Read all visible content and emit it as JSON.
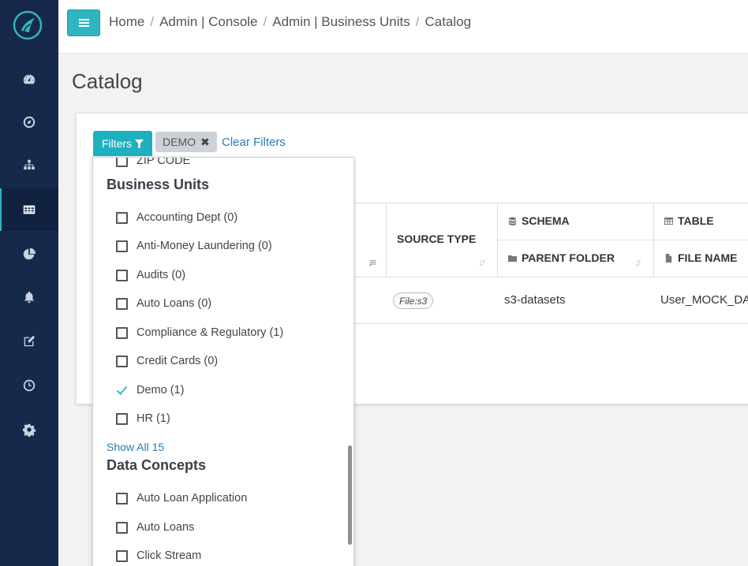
{
  "sidebar": {
    "items": [
      {
        "icon": "dashboard-icon"
      },
      {
        "icon": "compass-icon"
      },
      {
        "icon": "sitemap-icon"
      },
      {
        "icon": "table-icon",
        "active": true
      },
      {
        "icon": "pie-chart-icon"
      },
      {
        "icon": "bell-icon"
      },
      {
        "icon": "edit-icon"
      },
      {
        "icon": "clock-icon"
      },
      {
        "icon": "gear-icon"
      }
    ]
  },
  "header": {
    "breadcrumb": [
      "Home",
      "Admin | Console",
      "Admin | Business Units",
      "Catalog"
    ]
  },
  "page": {
    "title": "Catalog"
  },
  "filters": {
    "button_label": "Filters",
    "active_chip": "DEMO",
    "clear_label": "Clear Filters"
  },
  "dropdown": {
    "partial_item": "ZIP CODE",
    "business_units": {
      "title": "Business Units",
      "items": [
        {
          "label": "Accounting Dept (0)",
          "checked": false
        },
        {
          "label": "Anti-Money Laundering (0)",
          "checked": false
        },
        {
          "label": "Audits (0)",
          "checked": false
        },
        {
          "label": "Auto Loans (0)",
          "checked": false
        },
        {
          "label": "Compliance & Regulatory (1)",
          "checked": false
        },
        {
          "label": "Credit Cards (0)",
          "checked": false
        },
        {
          "label": "Demo (1)",
          "checked": true
        },
        {
          "label": "HR (1)",
          "checked": false
        }
      ],
      "show_all": "Show All 15"
    },
    "data_concepts": {
      "title": "Data Concepts",
      "items": [
        {
          "label": "Auto Loan Application",
          "checked": false
        },
        {
          "label": "Auto Loans",
          "checked": false
        },
        {
          "label": "Click Stream",
          "checked": false
        }
      ]
    }
  },
  "table": {
    "headers": {
      "source_type": "SOURCE TYPE",
      "schema": "SCHEMA",
      "table": "TABLE",
      "parent_folder": "PARENT FOLDER",
      "file_name": "FILE NAME"
    },
    "rows": [
      {
        "source_type": "File:s3",
        "schema": "s3-datasets",
        "table": "User_MOCK_DA"
      }
    ]
  },
  "colors": {
    "accent": "#1fb0bf",
    "sidebar": "#17294a",
    "link": "#2a7ab0"
  }
}
